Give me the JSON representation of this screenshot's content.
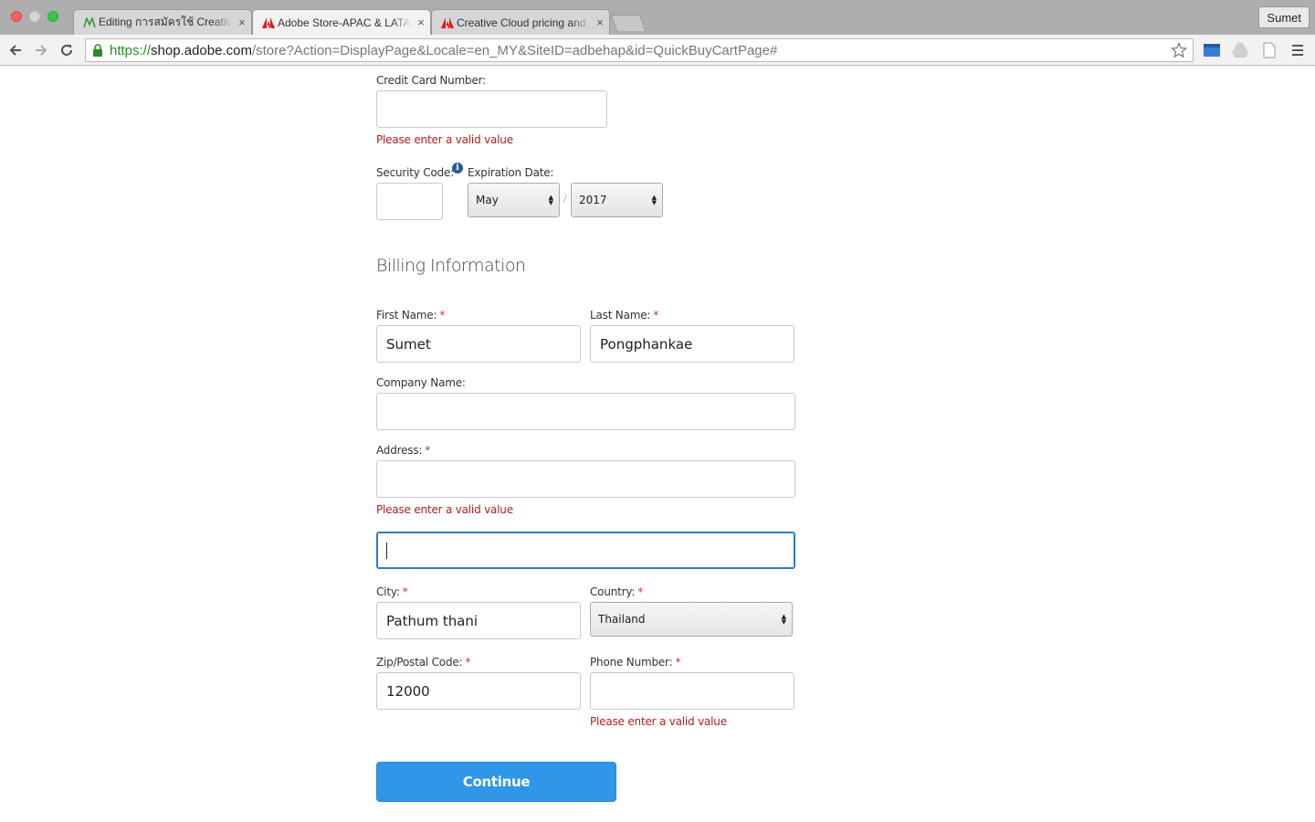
{
  "browser": {
    "tabs": [
      {
        "title": "Editing การสมัครใช้ Creative",
        "icon": "edit-page-favicon",
        "close": "×"
      },
      {
        "title": "Adobe Store-APAC & LATAM",
        "icon": "adobe-favicon",
        "close": "×"
      },
      {
        "title": "Creative Cloud pricing and",
        "icon": "adobe-favicon",
        "close": "×"
      }
    ],
    "profile_label": "Sumet",
    "url": {
      "scheme": "https://",
      "host": "shop.adobe.com",
      "path": "/store?Action=DisplayPage&Locale=en_MY&SiteID=adbehap&id=QuickBuyCartPage#"
    }
  },
  "payment": {
    "card_number_label": "Credit Card Number:",
    "card_number_value": "",
    "card_number_error": "Please enter a valid value",
    "security_code_label": "Security Code:",
    "security_code_value": "",
    "expiration_label": "Expiration Date:",
    "expiration_month": "May",
    "expiration_separator": "/",
    "expiration_year": "2017"
  },
  "billing": {
    "title": "Billing Information",
    "required_marker": "*",
    "first_name_label": "First Name:",
    "first_name_value": "Sumet",
    "last_name_label": "Last Name:",
    "last_name_value": "Pongphankae",
    "company_label": "Company Name:",
    "company_value": "",
    "address_label": "Address:",
    "address_value": "",
    "address_error": "Please enter a valid value",
    "address2_value": "",
    "city_label": "City:",
    "city_value": "Pathum thani",
    "country_label": "Country:",
    "country_value": "Thailand",
    "zip_label": "Zip/Postal Code:",
    "zip_value": "12000",
    "phone_label": "Phone Number:",
    "phone_value": "",
    "phone_error": "Please enter a valid value",
    "continue_label": "Continue"
  },
  "colors": {
    "accent": "#2f96e8",
    "error": "#b71c1c",
    "focus": "#2f79c5"
  }
}
